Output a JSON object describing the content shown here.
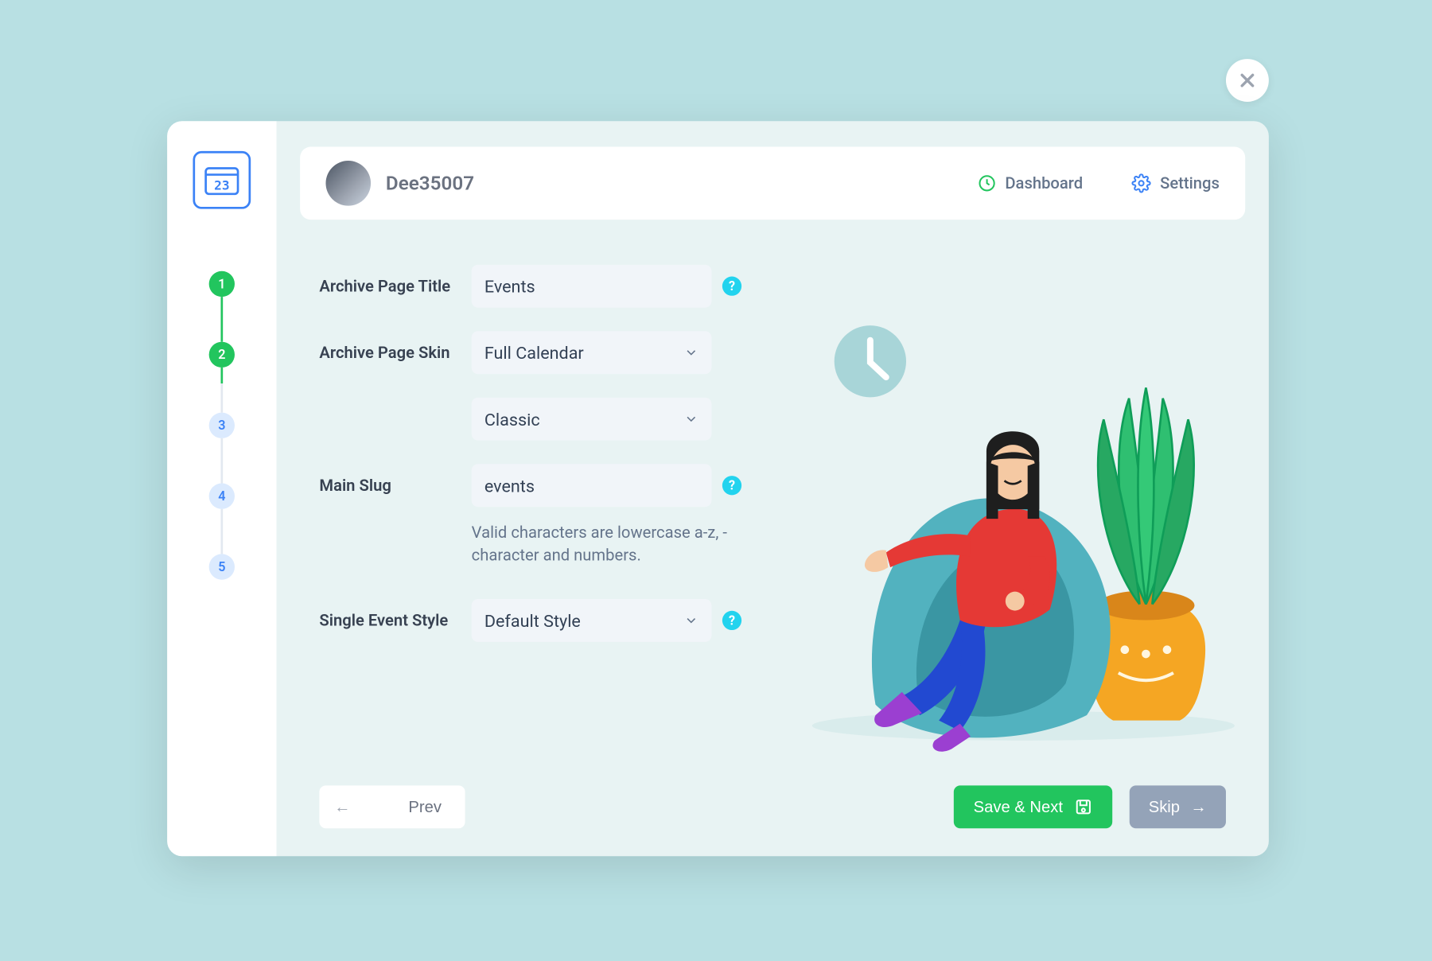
{
  "header": {
    "username": "Dee35007",
    "dashboard_label": "Dashboard",
    "settings_label": "Settings"
  },
  "steps": [
    "1",
    "2",
    "3",
    "4",
    "5"
  ],
  "form": {
    "archive_title_label": "Archive Page Title",
    "archive_title_value": "Events",
    "archive_skin_label": "Archive Page Skin",
    "archive_skin_value": "Full Calendar",
    "archive_skin_sub_value": "Classic",
    "main_slug_label": "Main Slug",
    "main_slug_value": "events",
    "main_slug_help": "Valid characters are lowercase a-z, - character and numbers.",
    "single_style_label": "Single Event Style",
    "single_style_value": "Default Style"
  },
  "footer": {
    "prev_label": "Prev",
    "save_label": "Save & Next",
    "skip_label": "Skip"
  }
}
